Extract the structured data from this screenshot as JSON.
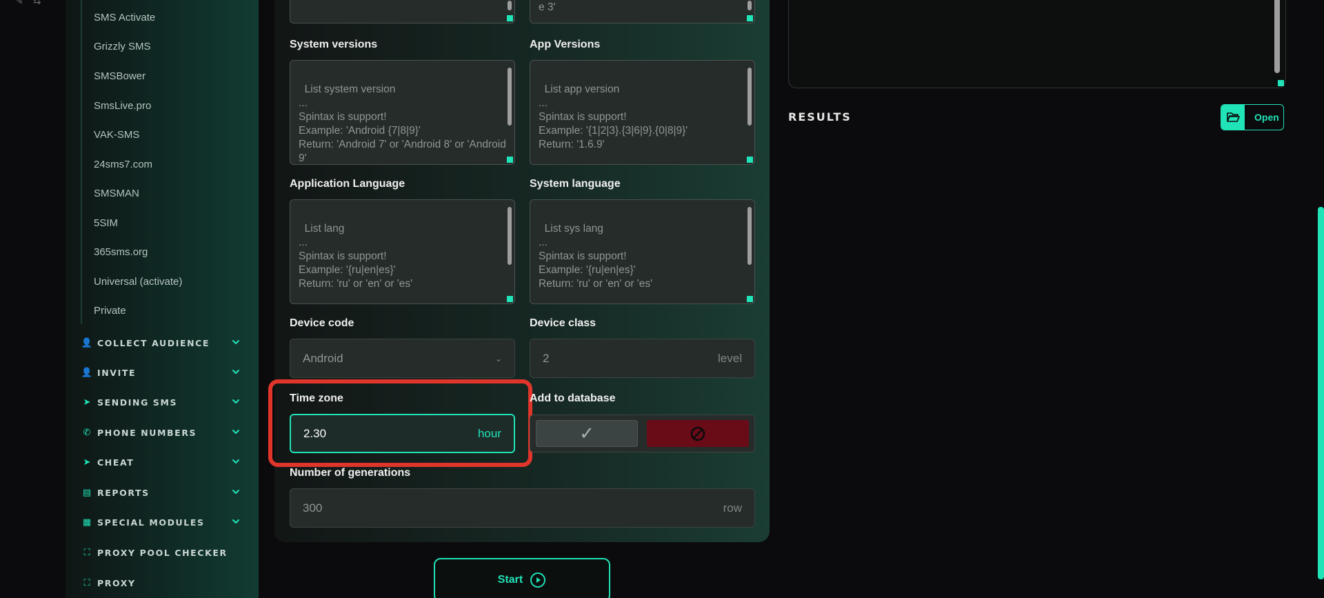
{
  "sidebar": {
    "sub_items": [
      "SMS Activate",
      "Grizzly SMS",
      "SMSBower",
      "SmsLive.pro",
      "VAK-SMS",
      "24sms7.com",
      "SMSMAN",
      "5SIM",
      "365sms.org",
      "Universal (activate)",
      "Private"
    ],
    "nav": [
      {
        "label": "COLLECT AUDIENCE",
        "icon": "users-icon"
      },
      {
        "label": "INVITE",
        "icon": "user-add-icon"
      },
      {
        "label": "SENDING SMS",
        "icon": "send-icon"
      },
      {
        "label": "PHONE NUMBERS",
        "icon": "phone-icon"
      },
      {
        "label": "CHEAT",
        "icon": "send-plus-icon"
      },
      {
        "label": "REPORTS",
        "icon": "report-icon"
      },
      {
        "label": "SPECIAL MODULES",
        "icon": "table-icon"
      },
      {
        "label": "PROXY POOL CHECKER",
        "icon": "network-icon"
      },
      {
        "label": "PROXY",
        "icon": "network-icon"
      }
    ]
  },
  "form": {
    "top_right_snippet": "e 3'",
    "system_versions": {
      "label": "System versions",
      "placeholder": "List system version\n...\nSpintax is support!\nExample: 'Android {7|8|9}'\nReturn: 'Android 7' or 'Android 8' or 'Android 9'"
    },
    "app_versions": {
      "label": "App Versions",
      "placeholder": "List app version\n...\nSpintax is support!\nExample: '{1|2|3}.{3|6|9}.{0|8|9}'\nReturn: '1.6.9'"
    },
    "app_language": {
      "label": "Application Language",
      "placeholder": "List lang\n...\nSpintax is support!\nExample: '{ru|en|es}'\nReturn: 'ru' or 'en' or 'es'"
    },
    "system_language": {
      "label": "System language",
      "placeholder": "List sys lang\n...\nSpintax is support!\nExample: '{ru|en|es}'\nReturn: 'ru' or 'en' or 'es'"
    },
    "device_code": {
      "label": "Device code",
      "value": "Android"
    },
    "device_class": {
      "label": "Device class",
      "value": "2",
      "unit": "level"
    },
    "time_zone": {
      "label": "Time zone",
      "value": "2.30",
      "unit": "hour"
    },
    "add_to_db": {
      "label": "Add to database"
    },
    "generations": {
      "label": "Number of generations",
      "value": "300",
      "unit": "row"
    },
    "start": "Start"
  },
  "results": {
    "title": "RESULTS",
    "open": "Open"
  },
  "colors": {
    "accent": "#20e3b8",
    "danger": "#6a0b18",
    "highlight": "#e0352b"
  }
}
